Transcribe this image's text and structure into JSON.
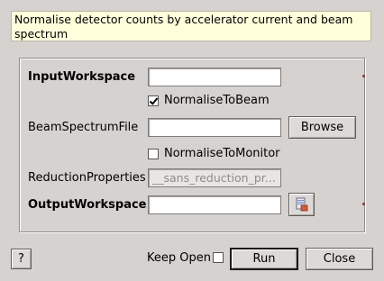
{
  "description": "Normalise detector counts by accelerator current and beam spectrum",
  "fields": {
    "input_workspace": {
      "label": "InputWorkspace",
      "value": ""
    },
    "normalise_to_beam": {
      "label": "NormaliseToBeam",
      "checked": true
    },
    "beam_spectrum_file": {
      "label": "BeamSpectrumFile",
      "value": ""
    },
    "browse_label": "Browse",
    "normalise_to_monitor": {
      "label": "NormaliseToMonitor",
      "checked": false
    },
    "reduction_properties": {
      "label": "ReductionProperties",
      "value": "__sans_reduction_pr..."
    },
    "output_workspace": {
      "label": "OutputWorkspace",
      "value": ""
    }
  },
  "footer": {
    "help_label": "?",
    "keep_open_label": "Keep Open",
    "keep_open_checked": false,
    "run_label": "Run",
    "close_label": "Close"
  },
  "icons": {
    "workspace_picker": "workspace-icon"
  }
}
